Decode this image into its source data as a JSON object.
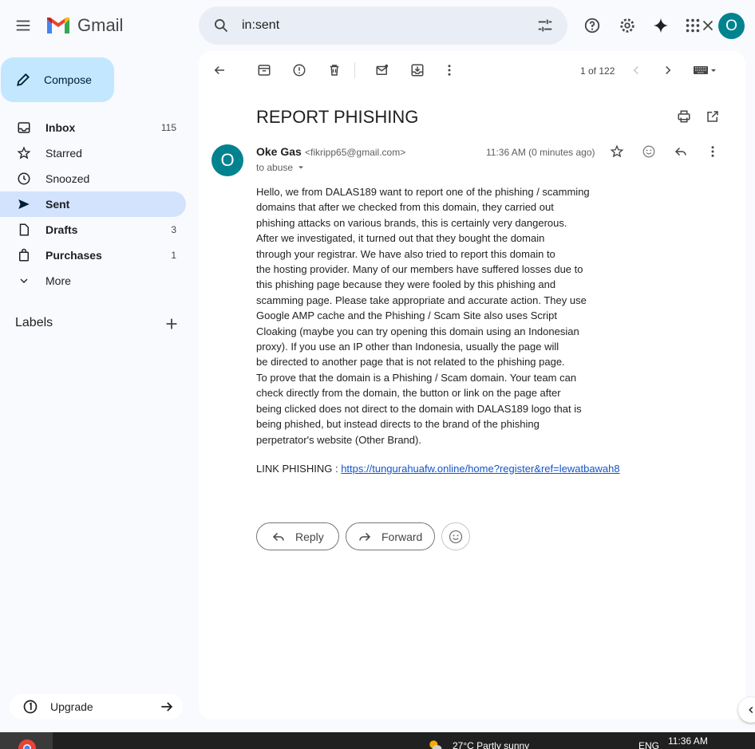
{
  "app": {
    "name": "Gmail"
  },
  "search": {
    "value": "in:sent"
  },
  "header": {
    "avatar_letter": "O"
  },
  "sidebar": {
    "compose_label": "Compose",
    "items": [
      {
        "label": "Inbox",
        "count": "115",
        "icon": "inbox-icon"
      },
      {
        "label": "Starred",
        "count": "",
        "icon": "star-icon"
      },
      {
        "label": "Snoozed",
        "count": "",
        "icon": "clock-icon"
      },
      {
        "label": "Sent",
        "count": "",
        "icon": "send-icon"
      },
      {
        "label": "Drafts",
        "count": "3",
        "icon": "draft-icon"
      },
      {
        "label": "Purchases",
        "count": "1",
        "icon": "bag-icon"
      },
      {
        "label": "More",
        "count": "",
        "icon": "chevron-down-icon"
      }
    ],
    "labels_header": "Labels",
    "upgrade_label": "Upgrade"
  },
  "toolbar": {
    "page_count": "1 of 122"
  },
  "email": {
    "subject": "REPORT PHISHING",
    "sender_avatar": "O",
    "sender_name": "Oke Gas",
    "sender_email": "<fikripp65@gmail.com>",
    "to_line": "to abuse",
    "timestamp": "11:36 AM (0 minutes ago)",
    "body_lines": [
      "Hello, we from DALAS189  want to report one of the phishing / scamming",
      "domains that after we checked from this domain, they carried out",
      "phishing attacks on various brands, this is certainly very dangerous.",
      "After we investigated, it turned out that they bought the domain",
      "through your registrar. We have also tried to report this domain to",
      "the hosting provider. Many of our members have suffered losses due to",
      "this phishing page because they were fooled by this phishing and",
      "scamming page. Please take appropriate and accurate action. They use",
      "Google AMP cache and the Phishing / Scam Site also uses Script",
      "Cloaking (maybe you can try opening this domain using an Indonesian",
      "proxy). If you use an IP other than Indonesia, usually the page will",
      "be directed to another page that is not related to the phishing page.",
      "To prove that the domain is a Phishing / Scam domain. Your team can",
      "check directly from the domain, the button or link on the page after",
      "being clicked does not direct to the domain with DALAS189 logo that is",
      "being phished, but instead directs to the brand of the phishing",
      "perpetrator's website (Other Brand)."
    ],
    "link_prefix": "LINK PHISHING : ",
    "link_url": "https://tungurahuafw.online/home?register&ref=lewatbawah8",
    "reply_label": "Reply",
    "forward_label": "Forward"
  },
  "taskbar": {
    "weather": "27°C  Partly sunny",
    "language": "ENG",
    "time": "11:36 AM"
  },
  "colors": {
    "accent": "#0b57d0",
    "compose_bg": "#c2e7ff",
    "active_nav": "#d3e3fd",
    "avatar": "#00838f",
    "link": "#1155cc"
  }
}
